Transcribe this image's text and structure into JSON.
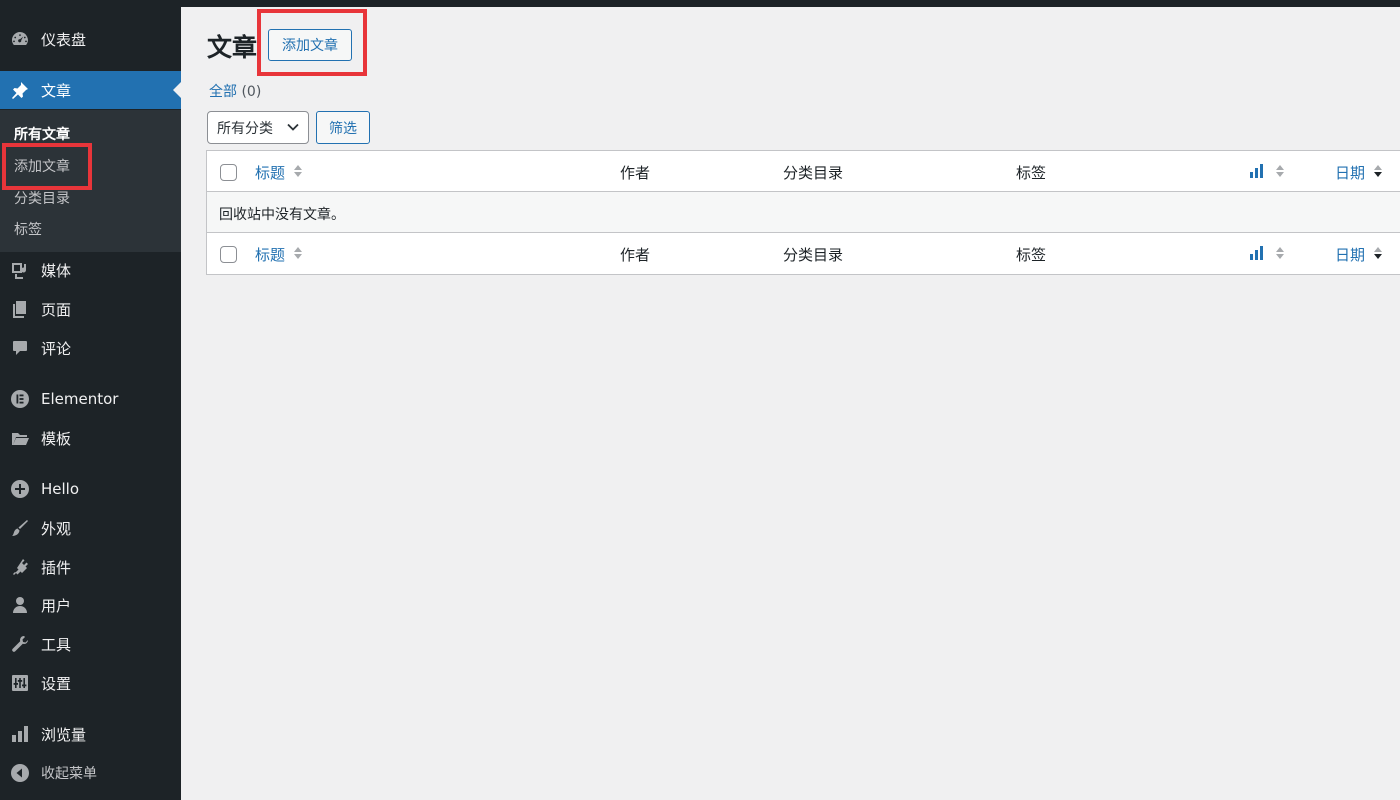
{
  "sidebar": {
    "dashboard": "仪表盘",
    "posts": "文章",
    "posts_submenu": [
      "所有文章",
      "添加文章",
      "分类目录",
      "标签"
    ],
    "media": "媒体",
    "pages": "页面",
    "comments": "评论",
    "elementor": "Elementor",
    "templates": "模板",
    "hello": "Hello",
    "appearance": "外观",
    "plugins": "插件",
    "users": "用户",
    "tools": "工具",
    "settings": "设置",
    "views": "浏览量",
    "collapse": "收起菜单"
  },
  "main": {
    "title": "文章",
    "add_new": "添加文章",
    "view_all": "全部",
    "view_all_count": "(0)",
    "category_select": "所有分类",
    "filter": "筛选",
    "columns": {
      "title": "标题",
      "author": "作者",
      "categories": "分类目录",
      "tags": "标签",
      "date": "日期"
    },
    "empty_message": "回收站中没有文章。"
  },
  "colors": {
    "accent": "#2271b1",
    "sidebar_bg": "#1d2327",
    "highlight": "#e8353a"
  },
  "icons": {
    "dashboard": "dashboard-icon",
    "posts": "pin-icon",
    "media": "media-icon",
    "pages": "pages-icon",
    "comments": "comment-icon",
    "elementor": "elementor-icon",
    "templates": "folder-icon",
    "hello": "plus-circle-icon",
    "appearance": "brush-icon",
    "plugins": "plug-icon",
    "users": "user-icon",
    "tools": "wrench-icon",
    "settings": "settings-icon",
    "views": "bar-chart-icon",
    "collapse": "collapse-icon"
  }
}
